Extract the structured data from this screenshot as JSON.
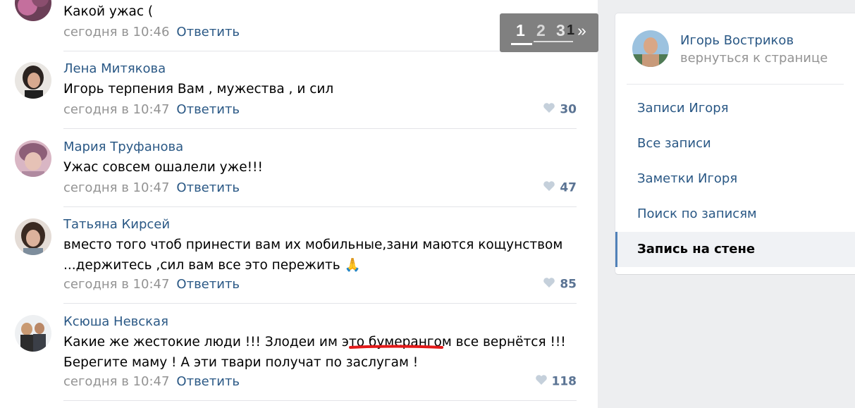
{
  "comments": [
    {
      "author": "",
      "text": "Какой ужас (",
      "time": "сегодня в 10:46",
      "reply": "Ответить",
      "likes": ""
    },
    {
      "author": "Лена Митякова",
      "text": "Игорь терпения Вам , мужества , и сил",
      "time": "сегодня в 10:47",
      "reply": "Ответить",
      "likes": "30"
    },
    {
      "author": "Мария Труфанова",
      "text": "Ужас совсем ошалели уже!!!",
      "time": "сегодня в 10:47",
      "reply": "Ответить",
      "likes": "47"
    },
    {
      "author": "Татьяна Кирсей",
      "text": "вместо того чтоб принести вам их мобильные,зани маются кощунством\n...держитесь ,сил вам все это пережить 🙏",
      "time": "сегодня в 10:47",
      "reply": "Ответить",
      "likes": "85"
    },
    {
      "author": "Ксюша Невская",
      "text": "Какие же жестокие люди !!! Злодеи им это бумерангом все вернётся !!!\nБерегите маму ! А эти твари получат по заслугам !",
      "time": "сегодня в 10:47",
      "reply": "Ответить",
      "likes": "118"
    }
  ],
  "pager": {
    "p1": "1",
    "p2": "2",
    "p3": "3",
    "p4": "1",
    "next": "»"
  },
  "panel": {
    "name": "Игорь Востриков",
    "back": "вернуться к странице",
    "menu": [
      {
        "label": "Записи Игоря",
        "active": false
      },
      {
        "label": "Все записи",
        "active": false
      },
      {
        "label": "Заметки Игоря",
        "active": false
      },
      {
        "label": "Поиск по записям",
        "active": false
      },
      {
        "label": "Запись на стене",
        "active": true
      }
    ]
  },
  "colors": {
    "link": "#2a5885",
    "meta": "#939393",
    "likes": "#5a7393",
    "active_border": "#5181b8",
    "annotation": "#e31a1a"
  }
}
